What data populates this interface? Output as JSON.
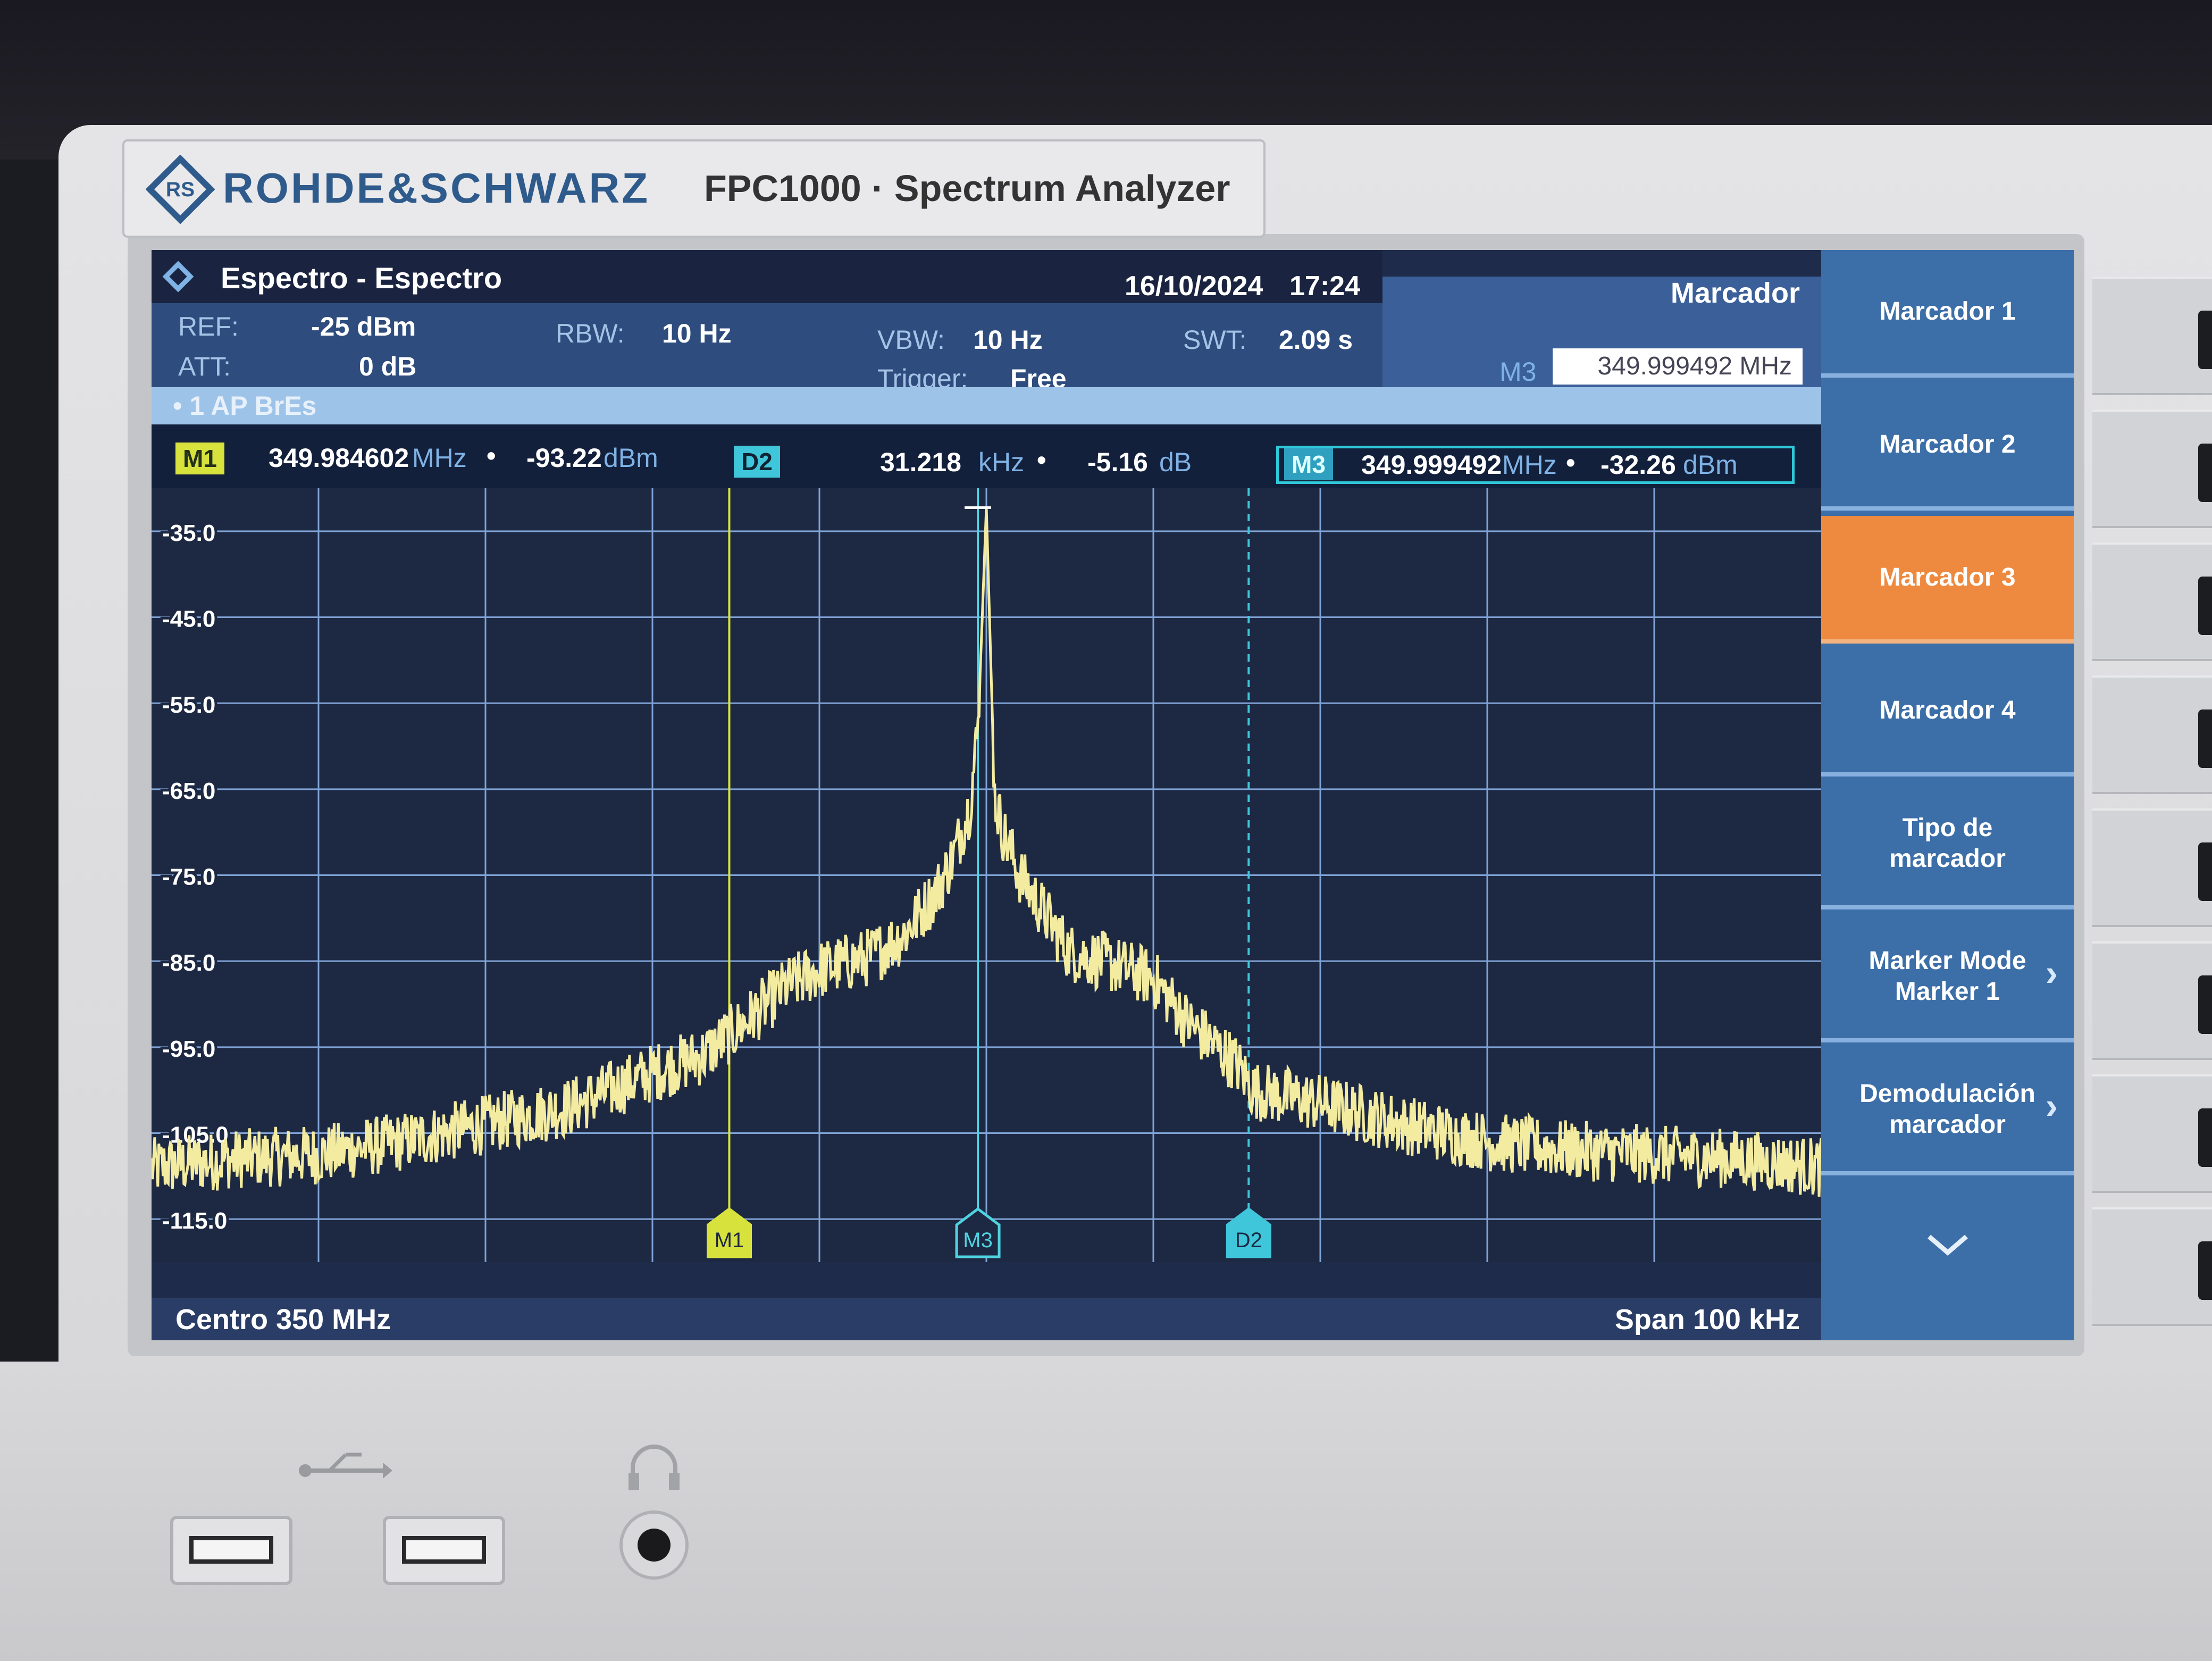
{
  "device": {
    "brand": "ROHDE&SCHWARZ",
    "model": "FPC1000 · Spectrum Analyzer",
    "ports": [
      "usb-port-1",
      "usb-port-2",
      "headphone-jack"
    ]
  },
  "title_bar": {
    "title": "Espectro - Espectro",
    "date": "16/10/2024",
    "time": "17:24"
  },
  "params": {
    "ref_label": "REF:",
    "ref_value": "-25 dBm",
    "att_label": "ATT:",
    "att_value": "0 dB",
    "rbw_label": "RBW:",
    "rbw_value": "10 Hz",
    "vbw_label": "VBW:",
    "vbw_value": "10 Hz",
    "trigger_label": "Trigger:",
    "trigger_value": "Free",
    "swt_label": "SWT:",
    "swt_value": "2.09 s",
    "trace_info": "• 1 AP BrEs"
  },
  "marker_panel": {
    "title": "Marcador",
    "active_label": "M3",
    "active_value": "349.999492 MHz"
  },
  "marker_readouts": {
    "m1_tag": "M1",
    "m1_freq": "349.984602",
    "m1_freq_unit": "MHz",
    "m1_level": "-93.22",
    "m1_level_unit": "dBm",
    "d2_tag": "D2",
    "d2_freq": "31.218",
    "d2_freq_unit": "kHz",
    "d2_level": "-5.16",
    "d2_level_unit": "dB",
    "m3_tag": "M3",
    "m3_freq": "349.999492",
    "m3_freq_unit": "MHz",
    "m3_level": "-32.26",
    "m3_level_unit": "dBm"
  },
  "footer": {
    "center": "Centro 350 MHz",
    "span": "Span 100 kHz"
  },
  "softkeys": [
    {
      "label": "Marcador 1",
      "active": false,
      "arrow": false
    },
    {
      "label": "Marcador 2",
      "active": false,
      "arrow": false
    },
    {
      "label": "Marcador 3",
      "active": true,
      "arrow": false
    },
    {
      "label": "Marcador 4",
      "active": false,
      "arrow": false
    },
    {
      "label": "Tipo de\nmarcador",
      "active": false,
      "arrow": false
    },
    {
      "label": "Marker Mode\nMarker 1",
      "active": false,
      "arrow": true
    },
    {
      "label": "Demodulación\nmarcador",
      "active": false,
      "arrow": true
    }
  ],
  "more_icon": "chevron-down-icon",
  "colors": {
    "trace": "#f3eca0",
    "grid": "#7fa3d6",
    "marker_m1": "#d8e23c",
    "marker_m3": "#4fd3e0",
    "marker_d2": "#3fc6da",
    "softkey_active": "#ee8a40",
    "softkey": "#3c6ea8"
  },
  "chart_data": {
    "type": "line",
    "x_unit": "MHz",
    "y_unit": "dBm",
    "xlim": [
      349.95,
      350.05
    ],
    "ylim": [
      -120,
      -30
    ],
    "ytick_labels": [
      "-35.0",
      "-45.0",
      "-55.0",
      "-65.0",
      "-75.0",
      "-85.0",
      "-95.0",
      "-105.0",
      "-115.0"
    ],
    "grid": true,
    "series": [
      {
        "x": [
          349.95,
          349.955,
          349.96,
          349.965,
          349.97,
          349.975,
          349.98,
          349.983,
          349.985,
          349.988,
          349.99,
          349.993,
          349.995,
          349.997,
          349.998,
          349.999,
          349.9995,
          350.0,
          350.0005,
          350.001,
          350.002,
          350.003,
          350.004,
          350.005,
          350.007,
          350.01,
          350.012,
          350.015,
          350.016,
          350.02,
          350.025,
          350.03,
          350.035,
          350.04,
          350.045,
          350.05
        ],
        "y": [
          -109,
          -108,
          -107.5,
          -106,
          -104,
          -102,
          -98,
          -96,
          -93,
          -88,
          -86,
          -84.5,
          -82,
          -77,
          -73,
          -67,
          -58,
          -32.3,
          -66,
          -70,
          -75,
          -78,
          -81,
          -84,
          -85,
          -87,
          -92,
          -97,
          -100,
          -101.5,
          -104,
          -106,
          -107,
          -107.5,
          -108,
          -109
        ]
      }
    ],
    "markers": [
      {
        "name": "M1",
        "x": 349.984602,
        "y": -93.22
      },
      {
        "name": "M3",
        "x": 349.999492,
        "y": -32.26
      },
      {
        "name": "D2",
        "x": 350.01571,
        "y": -98.38
      }
    ]
  }
}
